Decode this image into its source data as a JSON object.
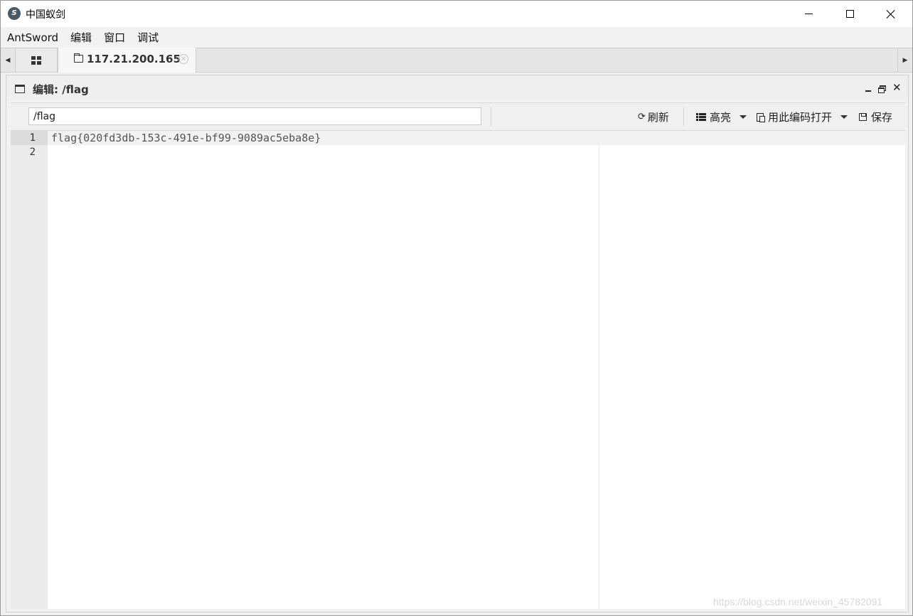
{
  "window": {
    "title": "中国蚁剑",
    "icon": "antsword-logo-icon"
  },
  "menu": {
    "items": [
      "AntSword",
      "编辑",
      "窗口",
      "调试"
    ]
  },
  "tabs": {
    "home_icon": "grid-icon",
    "active_tab": {
      "icon": "folder-icon",
      "label": "117.21.200.165",
      "close_icon": "close-circle-icon"
    }
  },
  "panel": {
    "title": "编辑: /flag",
    "icon": "window-icon"
  },
  "toolbar": {
    "path_value": "/flag",
    "refresh_label": "刷新",
    "highlight_label": "高亮",
    "open_with_encoding_label": "用此编码打开",
    "save_label": "保存"
  },
  "editor": {
    "lines": [
      {
        "number": "1",
        "text": "flag{020fd3db-153c-491e-bf99-9089ac5eba8e}"
      },
      {
        "number": "2",
        "text": ""
      }
    ]
  },
  "watermark": "https://blog.csdn.net/weixin_45782091"
}
